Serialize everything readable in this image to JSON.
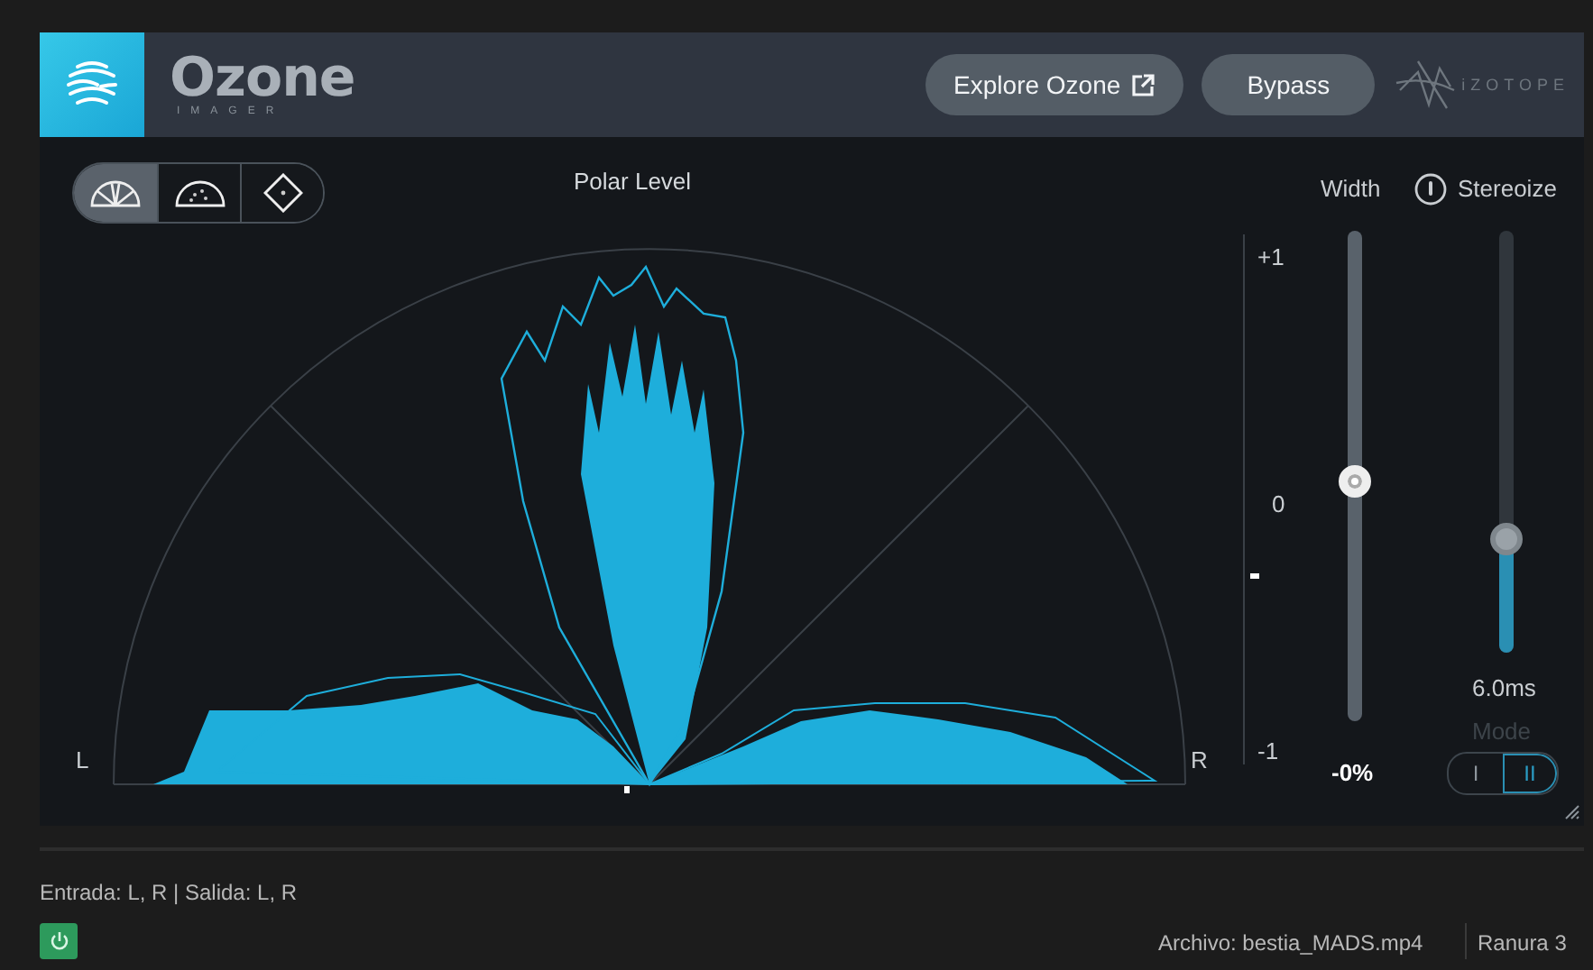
{
  "header": {
    "logo_title": "Ozone",
    "logo_subtitle": "IMAGER",
    "buttons": [
      {
        "label": "Explore Ozone",
        "kind": "external"
      },
      {
        "label": "Bypass",
        "kind": "plain"
      }
    ],
    "brand": "iZOTOPE"
  },
  "view_modes": [
    {
      "kind": "polar-level",
      "selected": true
    },
    {
      "kind": "polar-sample",
      "selected": false
    },
    {
      "kind": "lissajous",
      "selected": false
    }
  ],
  "plot": {
    "title": "Polar Level",
    "left_label": "L",
    "right_label": "R"
  },
  "meter": {
    "ticks": [
      "+1",
      "0",
      "-1"
    ],
    "level": 0.36
  },
  "width": {
    "label": "Width",
    "level": 0.49,
    "reading": "-0%"
  },
  "stereoize": {
    "label": "Stereoize",
    "level": 0.27,
    "reading": "6.0ms",
    "mode_label": "Mode",
    "modes": [
      {
        "label": "I",
        "selected": false
      },
      {
        "label": "II",
        "selected": true
      }
    ]
  },
  "status": {
    "io": "Entrada: L, R | Salida: L, R",
    "file": "Archivo: bestia_MADS.mp4",
    "slot": "Ranura 3"
  }
}
